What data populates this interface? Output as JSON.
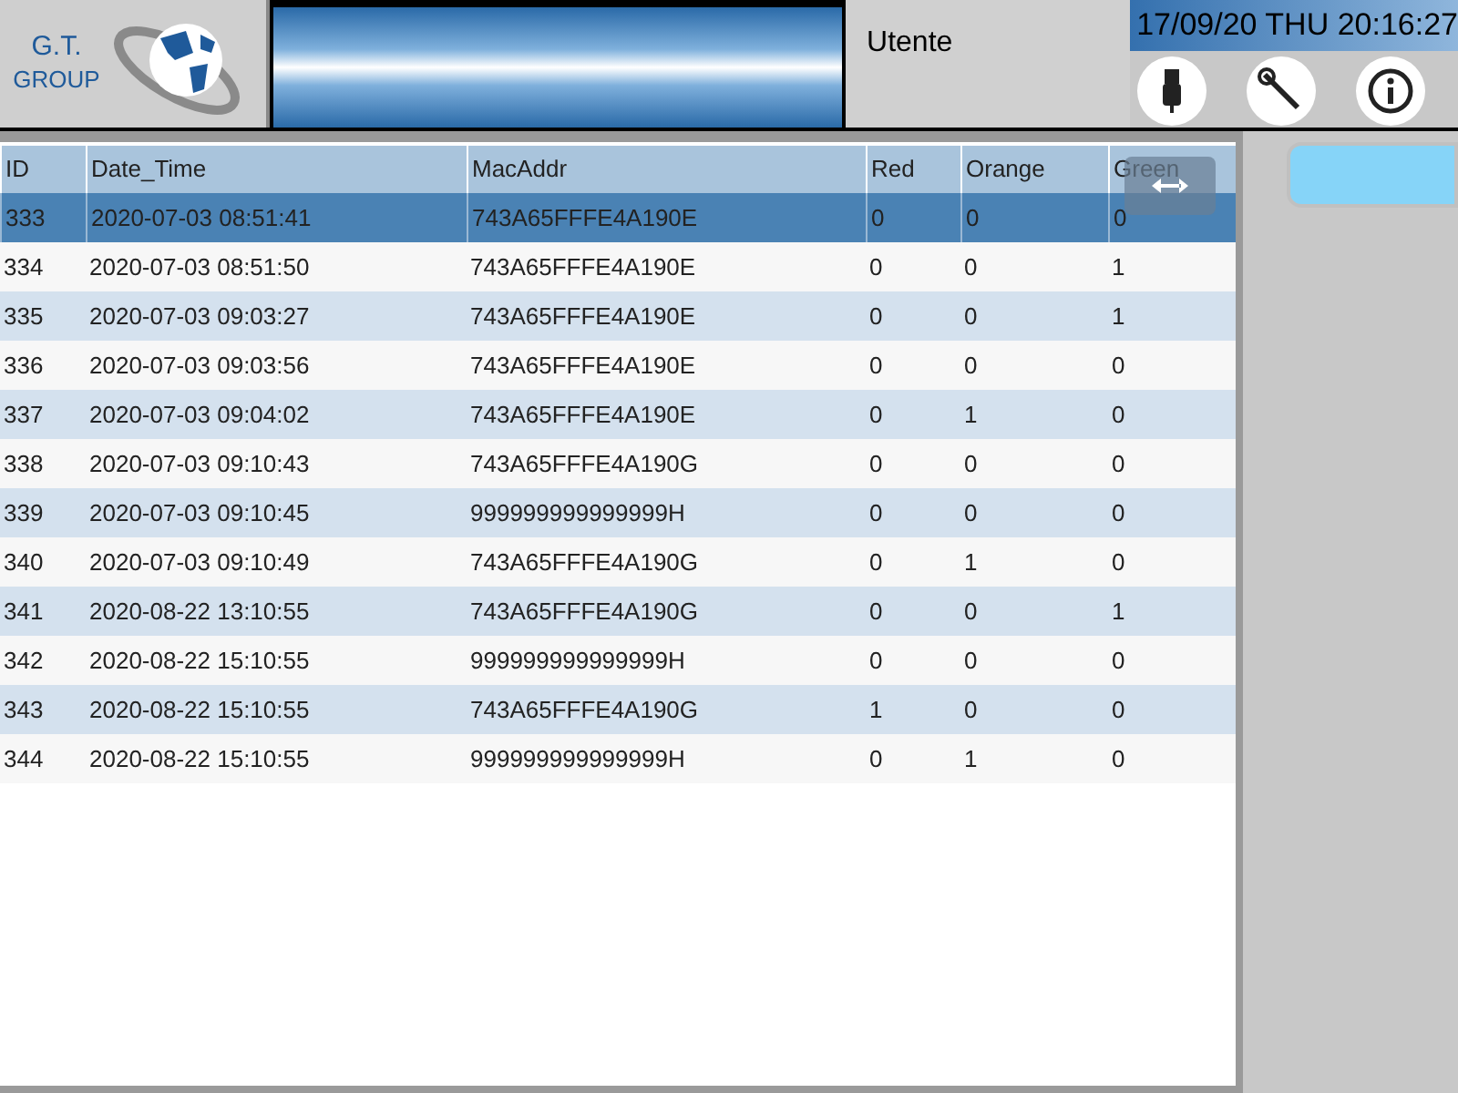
{
  "header": {
    "logo": {
      "line_1": "G.T.",
      "line_2": "GROUP"
    },
    "user": "Utente",
    "datetime": "17/09/20 THU 20:16:27"
  },
  "table": {
    "columns": [
      "ID",
      "Date_Time",
      "MacAddr",
      "Red",
      "Orange",
      "Green"
    ],
    "rows": [
      {
        "cells": [
          "333",
          "2020-07-03 08:51:41",
          "743A65FFFE4A190E",
          "0",
          "0",
          "0"
        ],
        "selected": true
      },
      {
        "cells": [
          "334",
          "2020-07-03 08:51:50",
          "743A65FFFE4A190E",
          "0",
          "0",
          "1"
        ],
        "selected": false
      },
      {
        "cells": [
          "335",
          "2020-07-03 09:03:27",
          "743A65FFFE4A190E",
          "0",
          "0",
          "1"
        ],
        "selected": false
      },
      {
        "cells": [
          "336",
          "2020-07-03 09:03:56",
          "743A65FFFE4A190E",
          "0",
          "0",
          "0"
        ],
        "selected": false
      },
      {
        "cells": [
          "337",
          "2020-07-03 09:04:02",
          "743A65FFFE4A190E",
          "0",
          "1",
          "0"
        ],
        "selected": false
      },
      {
        "cells": [
          "338",
          "2020-07-03 09:10:43",
          "743A65FFFE4A190G",
          "0",
          "0",
          "0"
        ],
        "selected": false
      },
      {
        "cells": [
          "339",
          "2020-07-03 09:10:45",
          "999999999999999H",
          "0",
          "0",
          "0"
        ],
        "selected": false
      },
      {
        "cells": [
          "340",
          "2020-07-03 09:10:49",
          "743A65FFFE4A190G",
          "0",
          "1",
          "0"
        ],
        "selected": false
      },
      {
        "cells": [
          "341",
          "2020-08-22 13:10:55",
          "743A65FFFE4A190G",
          "0",
          "0",
          "1"
        ],
        "selected": false
      },
      {
        "cells": [
          "342",
          "2020-08-22 15:10:55",
          "999999999999999H",
          "0",
          "0",
          "0"
        ],
        "selected": false
      },
      {
        "cells": [
          "343",
          "2020-08-22 15:10:55",
          "743A65FFFE4A190G",
          "1",
          "0",
          "0"
        ],
        "selected": false
      },
      {
        "cells": [
          "344",
          "2020-08-22 15:10:55",
          "999999999999999H",
          "0",
          "1",
          "0"
        ],
        "selected": false
      }
    ]
  }
}
